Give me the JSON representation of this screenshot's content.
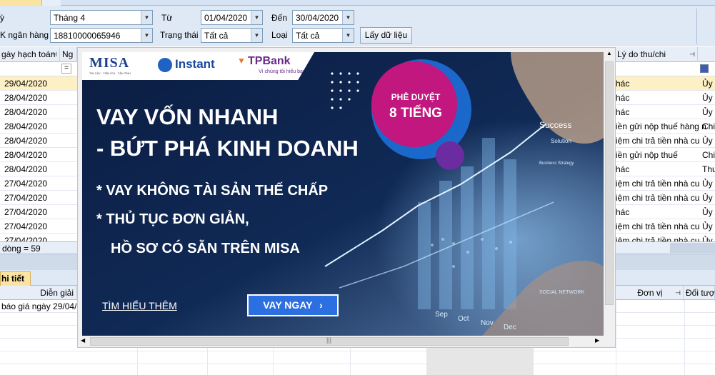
{
  "filters": {
    "ky_label": "ỳ",
    "ky_value": "Tháng 4",
    "tu_label": "Từ",
    "tu_value": "01/04/2020",
    "den_label": "Đến",
    "den_value": "30/04/2020",
    "tk_label": "K ngân hàng",
    "tk_value": "18810000065946",
    "trangthai_label": "Trạng thái",
    "trangthai_value": "Tất cả",
    "loai_label": "Loại",
    "loai_value": "Tất cả",
    "fetch_button": "Lấy dữ liệu"
  },
  "grid": {
    "col_date": "gày hạch toán",
    "col_ng": "Ng",
    "col_reason": "Lý do thu/chi",
    "filter_eq": "=",
    "rows": [
      {
        "date": "29/04/2020",
        "reason": "hác",
        "type": "Ủy"
      },
      {
        "date": "28/04/2020",
        "reason": "hác",
        "type": "Ủy"
      },
      {
        "date": "28/04/2020",
        "reason": "hác",
        "type": "Ủy"
      },
      {
        "date": "28/04/2020",
        "reason": "iền gửi nộp thuế hàng n",
        "type": "Chi"
      },
      {
        "date": "28/04/2020",
        "reason": "iệm chi trả tiền nhà cu",
        "type": "Ủy"
      },
      {
        "date": "28/04/2020",
        "reason": "iền gửi nộp thuế",
        "type": "Chi"
      },
      {
        "date": "28/04/2020",
        "reason": "hác",
        "type": "Thu"
      },
      {
        "date": "27/04/2020",
        "reason": "iệm chi trả tiền nhà cu",
        "type": "Ủy"
      },
      {
        "date": "27/04/2020",
        "reason": "iệm chi trả tiền nhà cu",
        "type": "Ủy"
      },
      {
        "date": "27/04/2020",
        "reason": "hác",
        "type": "Ủy"
      },
      {
        "date": "27/04/2020",
        "reason": "iệm chi trả tiền nhà cu",
        "type": "Ủy"
      },
      {
        "date": "27/04/2020",
        "reason": "iệm chi trả tiền nhà cu",
        "type": "Ủy"
      }
    ],
    "row_count": "dòng = 59"
  },
  "detail": {
    "tab_label": "hi tiết",
    "col_dien_giai": "Diễn giải",
    "col_don_vi": "Đơn vị",
    "col_doi_tuong": "Đối tượ",
    "first_row": "báo giá ngày 29/04/2"
  },
  "ad": {
    "misa_logo": "MISA",
    "misa_tagline": "TIN CẬY - TIỆN ÍCH - TẬN TÌNH",
    "instant_logo": "Instant",
    "tpbank_logo": "TPBank",
    "tpbank_tagline": "Vì chúng tôi hiểu bạn",
    "badge_line1": "PHÊ DUYỆT",
    "badge_line2": "8 TIẾNG",
    "headline1": "VAY VỐN NHANH",
    "headline2": "- BỨT PHÁ KINH DOANH",
    "bullet1": "*  VAY KHÔNG TÀI SẢN THẾ CHẤP",
    "bullet2": "*  THỦ TỤC ĐƠN GIẢN,",
    "bullet3": "HỒ SƠ CÓ SẴN TRÊN MISA",
    "learn_more": "TÌM HIỂU THÊM",
    "cta": "VAY NGAY",
    "bg_success": "Success",
    "bg_solution": "Solution",
    "bg_strategy": "Business Strategy",
    "bg_social": "SOCIAL NETWORK",
    "months": [
      "Sep",
      "Oct",
      "Nov",
      "Dec"
    ],
    "colors": {
      "navy": "#0c1f44",
      "magenta": "#c2177e",
      "purple": "#6a2ca0",
      "cta": "#2b6fe0"
    }
  }
}
